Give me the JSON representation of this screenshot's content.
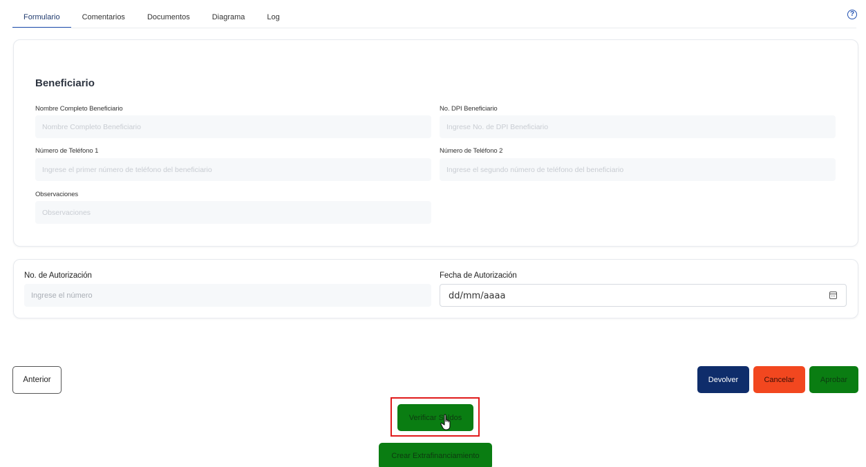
{
  "tabs": [
    "Formulario",
    "Comentarios",
    "Documentos",
    "Diagrama",
    "Log"
  ],
  "active_tab": "Formulario",
  "icons": {
    "help": "help-circle-icon",
    "calendar": "calendar-icon",
    "cursor": "hand-pointer-icon"
  },
  "beneficiario": {
    "title": "Beneficiario",
    "nombre": {
      "label": "Nombre Completo Beneficiario",
      "placeholder": "Nombre Completo Beneficiario"
    },
    "dpi": {
      "label": "No. DPI Beneficiario",
      "placeholder": "Ingrese No. de DPI Beneficiario"
    },
    "telefono1": {
      "label": "Número de Teléfono 1",
      "placeholder": "Ingrese el primer número de teléfono del beneficiario"
    },
    "telefono2": {
      "label": "Número de Teléfono 2",
      "placeholder": "Ingrese el segundo número de teléfono del beneficiario"
    },
    "observaciones": {
      "label": "Observaciones",
      "placeholder": "Observaciones"
    }
  },
  "autorizacion": {
    "numero": {
      "label": "No. de Autorización",
      "placeholder": "Ingrese el número"
    },
    "fecha": {
      "label": "Fecha de Autorización",
      "value": "dd/mm/aaaa"
    }
  },
  "buttons": {
    "anterior": "Anterior",
    "devolver": "Devolver",
    "cancelar": "Cancelar",
    "aprobar": "Aprobar",
    "verificar": "Verificar Saldos",
    "crear": "Crear Extrafinanciamiento"
  },
  "colors": {
    "navy": "#0f2d6b",
    "red": "#f2471f",
    "green": "#0a7d12",
    "highlight": "#e01a1a",
    "accent": "#1f4fb0"
  }
}
